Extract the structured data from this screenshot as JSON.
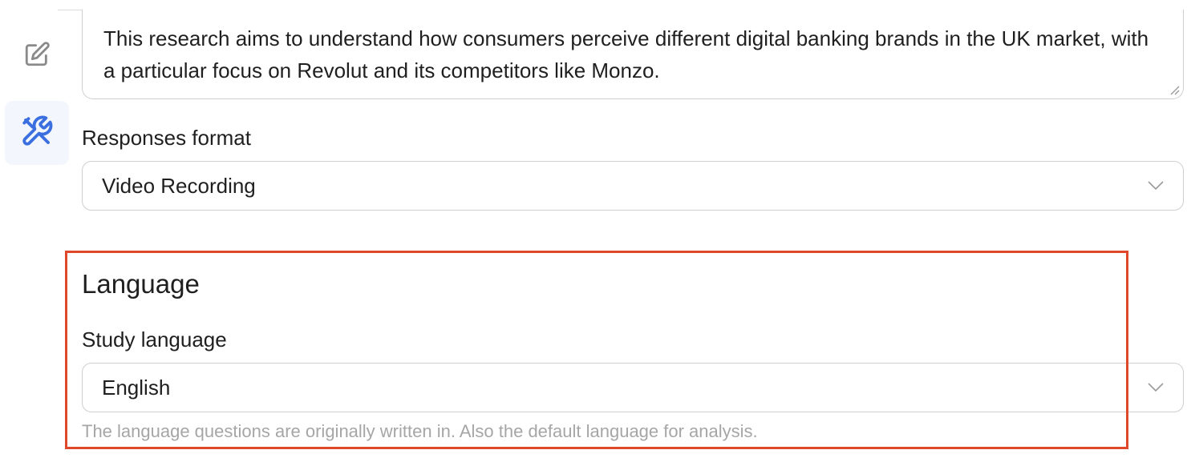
{
  "description": {
    "text": "This research aims to understand how consumers perceive different digital banking brands in the UK market, with a particular focus on Revolut and its competitors like Monzo."
  },
  "rail": {
    "items": [
      {
        "icon": "edit-icon",
        "active": false
      },
      {
        "icon": "tools-icon",
        "active": true
      }
    ]
  },
  "responses_format": {
    "label": "Responses format",
    "value": "Video Recording"
  },
  "language": {
    "heading": "Language",
    "study_language_label": "Study language",
    "value": "English",
    "helper": "The language questions are originally written in. Also the default language for analysis."
  },
  "colors": {
    "accent": "#3b6fe0",
    "highlight": "#e0482a",
    "active_bg": "#f3f6fd"
  }
}
